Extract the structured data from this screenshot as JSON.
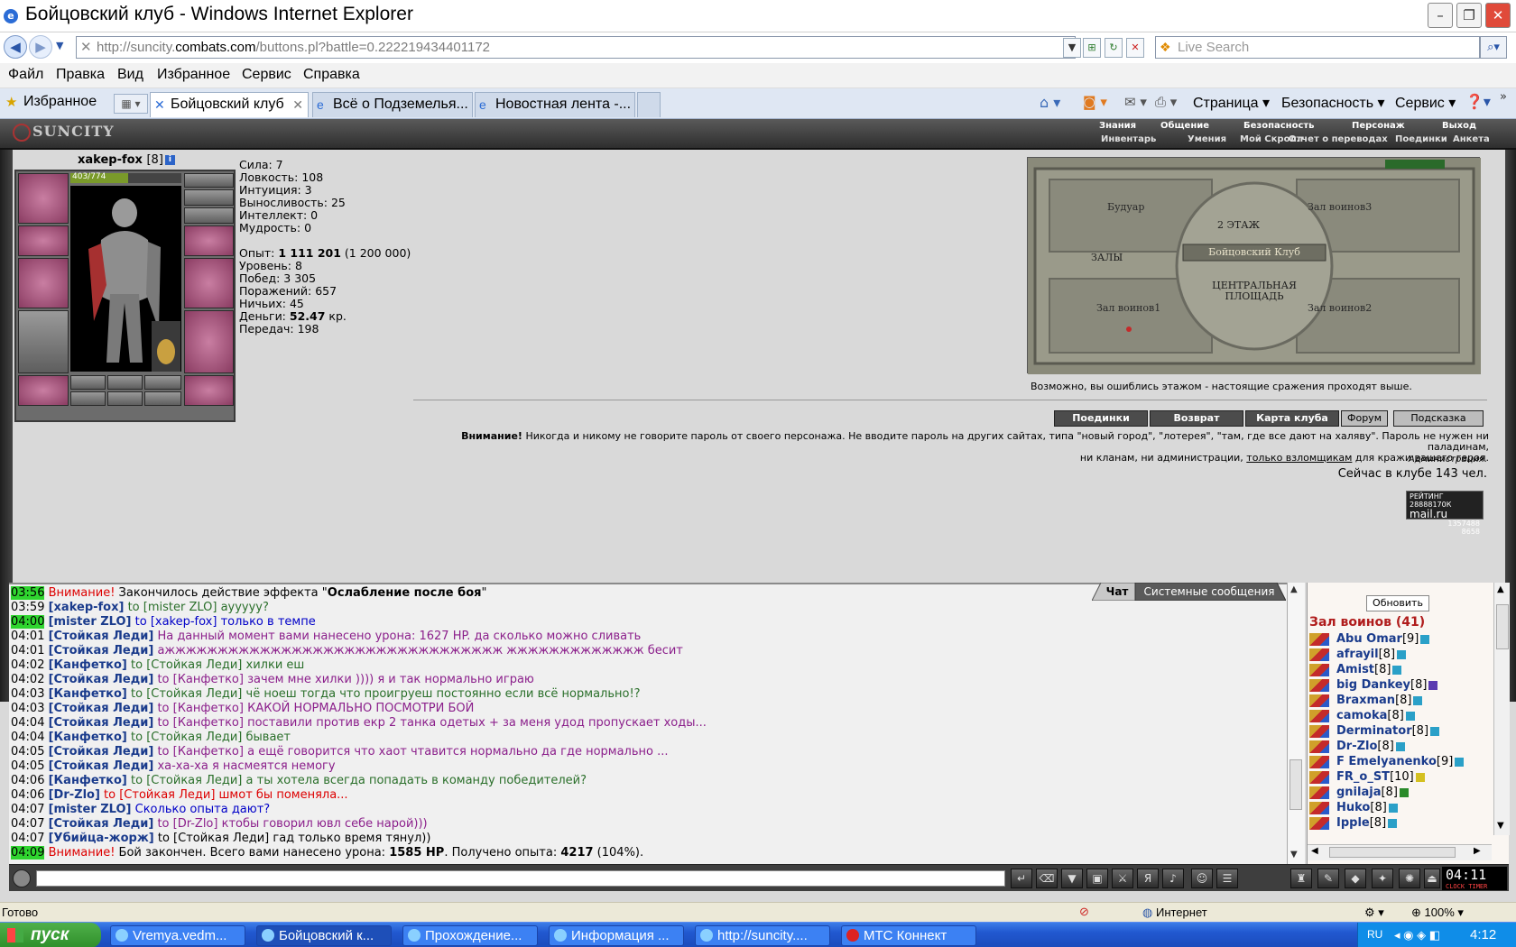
{
  "window": {
    "title": "Бойцовский клуб - Windows Internet Explorer",
    "min": "–",
    "max": "❐",
    "close": "✕"
  },
  "address": {
    "url_prefix": "http://suncity.",
    "url_host": "combats.com",
    "url_path": "/buttons.pl?battle=0.222219434401172",
    "search_placeholder": "Live Search"
  },
  "menu": [
    "Файл",
    "Правка",
    "Вид",
    "Избранное",
    "Сервис",
    "Справка"
  ],
  "tabs": {
    "favorites": "Избранное",
    "items": [
      "Бойцовский клуб",
      "Всё о Подземелья...",
      "Новостная лента -..."
    ],
    "commands": [
      "Страница",
      "Безопасность",
      "Сервис"
    ]
  },
  "game_nav": {
    "logo": "SUNCITY",
    "row1": [
      "Знания",
      "Общение",
      "Безопасность",
      "Персонаж",
      "Выход"
    ],
    "row2": [
      "Инвентарь",
      "Умения",
      "Мой Скролл",
      "Отчет о переводах",
      "Поединки",
      "Анкета"
    ]
  },
  "character": {
    "name": "xakep-fox",
    "level": "[8]",
    "hp": "403/774",
    "hp_fraction": 0.52
  },
  "stats": {
    "strength": "Сила: 7",
    "agility": "Ловкость: 108",
    "intuition": "Интуиция: 3",
    "endurance": "Выносливость: 25",
    "intellect": "Интеллект: 0",
    "wisdom": "Мудрость: 0",
    "exp_label": "Опыт: ",
    "exp_value": "1 111 201",
    "exp_next": " (1 200 000)",
    "level": "Уровень: 8",
    "wins": "Побед: 3 305",
    "losses": "Поражений: 657",
    "draws": "Ничьих: 45",
    "money_label": "Деньги: ",
    "money_value": "52.47",
    "money_unit": " кр.",
    "transfers": "Передач: 198"
  },
  "map": {
    "floor": "2 ЭТАЖ",
    "halls": "ЗАЛЫ",
    "center": "Бойцовский Клуб",
    "square": "ЦЕНТРАЛЬНАЯ ПЛОЩАДЬ",
    "boudoir": "Будуар",
    "hall1": "Зал воинов1",
    "hall2": "Зал воинов2",
    "hall3": "Зал воинов3",
    "caption": "Возможно, вы ошиблись этажом - настоящие сражения проходят выше."
  },
  "buttons": [
    "Поединки",
    "Возврат",
    "Карта клуба",
    "Форум",
    "Подсказка"
  ],
  "warning": {
    "strong": "Внимание!",
    "text1": " Никогда и никому не говорите пароль от своего персонажа. Не вводите пароль на других сайтах, типа \"новый город\", \"лотерея\", \"там, где все дают на халяву\". Пароль не нужен ни паладинам,",
    "text2": "ни кланам, ни администрации, ",
    "link": "только взломщикам",
    "text3": " для кражи вашего героя.",
    "admin": "Администрация.",
    "online": "Сейчас в клубе 143 чел."
  },
  "mailru": {
    "l1": "РЕЙТИНГ 28888170К",
    "l2": "mail.ru",
    "l3": "1357488",
    "l4": "8658"
  },
  "chat": {
    "tabs": [
      "Чат",
      "Системные сообщения"
    ],
    "lines": [
      {
        "t": "03:56",
        "hl": true,
        "nick": "",
        "to": "",
        "msg": "Закончилось действие эффекта ",
        "sys": "Внимание! ",
        "bold": "Ослабление после боя",
        "end": "\"",
        "q": "\""
      },
      {
        "t": "03:59",
        "nick": "[xakep-fox]",
        "to": " to [mister ZLO]",
        "msg": " ayyyyy?",
        "c": "g"
      },
      {
        "t": "04:00",
        "hl": true,
        "nick": "[mister ZLO]",
        "to": " to [xakep-fox]",
        "msg": " только в темпе",
        "c": "b"
      },
      {
        "t": "04:01",
        "nick": "[Стойкая Леди]",
        "to": "",
        "msg": " На данный момент вами нанесено урона: 1627 HP. да сколько можно сливать",
        "c": "m"
      },
      {
        "t": "04:01",
        "nick": "[Стойкая Леди]",
        "to": "",
        "msg": " ажжжжжжжжжжжжжжжжжжжжжжжжжжжжжжжж жжжжжжжжжжжжж бесит",
        "c": "m"
      },
      {
        "t": "04:02",
        "nick": "[Канфетко]",
        "to": " to [Стойкая Леди]",
        "msg": " хилки еш",
        "c": "g"
      },
      {
        "t": "04:02",
        "nick": "[Стойкая Леди]",
        "to": " to [Канфетко]",
        "msg": " зачем мне хилки )))) я и так нормально играю",
        "c": "m"
      },
      {
        "t": "04:03",
        "nick": "[Канфетко]",
        "to": " to [Стойкая Леди]",
        "msg": " чё ноеш тогда что проигрyеш постоянно если всё нормально!?",
        "c": "g"
      },
      {
        "t": "04:03",
        "nick": "[Стойкая Леди]",
        "to": " to [Канфетко]",
        "msg": " КАКОЙ НОРМАЛЬНО ПОСМОТРИ БОЙ",
        "c": "m"
      },
      {
        "t": "04:04",
        "nick": "[Стойкая Леди]",
        "to": " to [Канфетко]",
        "msg": " поставили против екр 2 танка одетых + за меня удод пропускает ходы...",
        "c": "m"
      },
      {
        "t": "04:04",
        "nick": "[Канфетко]",
        "to": " to [Стойкая Леди]",
        "msg": " бывает",
        "c": "g"
      },
      {
        "t": "04:05",
        "nick": "[Стойкая Леди]",
        "to": " to [Канфетко]",
        "msg": " а ещё говорится что хаот чтавится нормально да где нормально ...",
        "c": "m"
      },
      {
        "t": "04:05",
        "nick": "[Стойкая Леди]",
        "to": "",
        "msg": " ха-ха-ха я насмеятся немогу",
        "c": "m"
      },
      {
        "t": "04:06",
        "nick": "[Канфетко]",
        "to": " to [Стойкая Леди]",
        "msg": " а ты хотела всегда попадать в команду победителей?",
        "c": "g"
      },
      {
        "t": "04:06",
        "nick": "[Dr-Zlo]",
        "to": " to [Стойкая Леди]",
        "msg": " шмот бы поменяла...",
        "c": "r"
      },
      {
        "t": "04:07",
        "nick": "[mister ZLO]",
        "to": "",
        "msg": " Сколько опыта дают?",
        "c": "b"
      },
      {
        "t": "04:07",
        "nick": "[Стойкая Леди]",
        "to": " to [Dr-Zlo]",
        "msg": " ктобы говорил ювл себе нарой)))",
        "c": "m"
      },
      {
        "t": "04:07",
        "nick": "[Убийца-жорж]",
        "to": " to [Стойкая Леди]",
        "msg": " гад только время тянул))",
        "c": "t"
      },
      {
        "t": "04:09",
        "hl": true,
        "nick": "",
        "to": "",
        "sys": "Внимание! ",
        "msg": "Бой закончен. Всего вами нанесено урона: ",
        "bold": "1585 HP",
        "mid": ". Получено опыта: ",
        "bold2": "4217",
        "end": " (104%)."
      }
    ]
  },
  "users": {
    "refresh": "Обновить",
    "room": "Зал воинов (41)",
    "list": [
      {
        "n": "Abu Omar",
        "l": "[9]",
        "c": ""
      },
      {
        "n": "afrayil",
        "l": "[8]",
        "c": ""
      },
      {
        "n": "Amist",
        "l": "[8]",
        "c": ""
      },
      {
        "n": "big Dankey",
        "l": "[8]",
        "c": "pu"
      },
      {
        "n": "Braxman",
        "l": "[8]",
        "c": ""
      },
      {
        "n": "camoka",
        "l": "[8]",
        "c": ""
      },
      {
        "n": "Derminator",
        "l": "[8]",
        "c": ""
      },
      {
        "n": "Dr-Zlo",
        "l": "[8]",
        "c": ""
      },
      {
        "n": "F Emelyanenko",
        "l": "[9]",
        "c": ""
      },
      {
        "n": "FR_o_ST",
        "l": "[10]",
        "c": "y"
      },
      {
        "n": "gnilaja",
        "l": "[8]",
        "c": "gg"
      },
      {
        "n": "Huko",
        "l": "[8]",
        "c": ""
      },
      {
        "n": "Ipple",
        "l": "[8]",
        "c": ""
      }
    ]
  },
  "clock": {
    "time": "04:11",
    "label": "CLOCK TIMER"
  },
  "status": {
    "ready": "Готово",
    "zone": "Интернет",
    "zoom": "100%"
  },
  "taskbar": {
    "start": "пуск",
    "items": [
      "Vremya.vedm...",
      "Бойцовский к...",
      "Прохождение...",
      "Информация ...",
      "http://suncity....",
      "МТС Коннект"
    ],
    "lang": "RU",
    "time": "4:12"
  }
}
